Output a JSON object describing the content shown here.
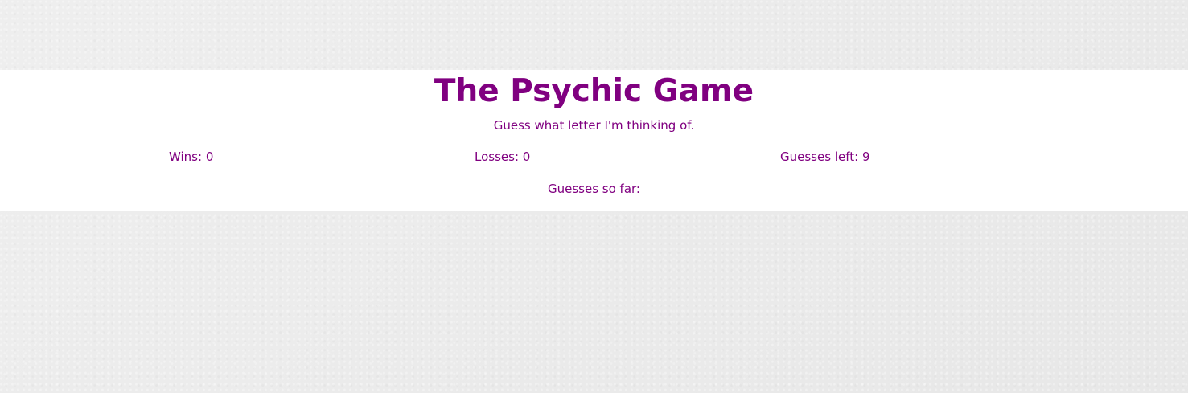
{
  "game": {
    "title": "The Psychic Game",
    "subtitle": "Guess what letter I'm thinking of.",
    "stats": {
      "wins_label": "Wins:",
      "wins": "0",
      "losses_label": "Losses:",
      "losses": "0",
      "guesses_left_label": "Guesses left:",
      "guesses_left": "9"
    },
    "guesses_so_far_label": "Guesses so far:",
    "guesses_so_far": ""
  },
  "colors": {
    "text": "#800080",
    "panel_background": "#ffffff",
    "page_background": "#ececec"
  }
}
